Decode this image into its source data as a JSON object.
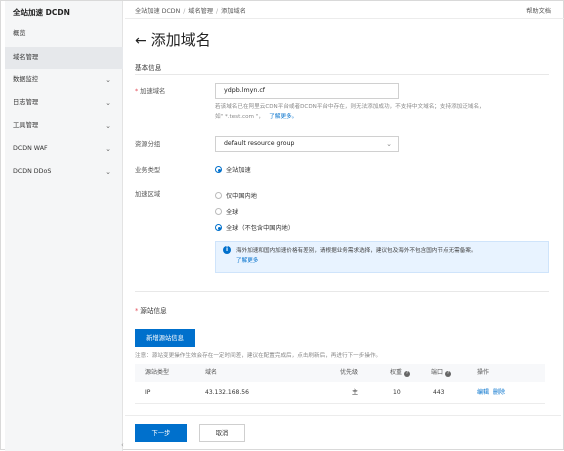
{
  "sidebar": {
    "brand": "全站加速 DCDN",
    "items": [
      {
        "label": "概览",
        "chevron": false,
        "active": false
      },
      {
        "label": "域名管理",
        "chevron": false,
        "active": true
      },
      {
        "label": "数据监控",
        "chevron": true,
        "active": false
      },
      {
        "label": "日志管理",
        "chevron": true,
        "active": false
      },
      {
        "label": "工具管理",
        "chevron": true,
        "active": false
      },
      {
        "label": "DCDN WAF",
        "chevron": true,
        "active": false
      },
      {
        "label": "DCDN DDoS",
        "chevron": true,
        "active": false
      }
    ]
  },
  "topbar": {
    "breadcrumb": [
      "全站加速 DCDN",
      "域名管理",
      "添加域名"
    ],
    "help": "帮助文档"
  },
  "page": {
    "back_arrow": "←",
    "title": "添加域名"
  },
  "basic": {
    "section_title": "基本信息",
    "domain_label": "加速域名",
    "domain_value": "ydpb.lmyn.cf",
    "domain_hint_1": "若该域名已在阿里云CDN平台或者DCDN平台中存在，则无法添加成功，不支持中文域名；支持添加泛域名，",
    "domain_hint_2": "如\"  *.test.com \"，",
    "domain_hint_link": "了解更多。",
    "resource_group_label": "资源分组",
    "resource_group_value": "default resource group",
    "business_type_label": "业务类型",
    "business_type_option": "全站加速",
    "region_label": "加速区域",
    "region_options": [
      "仅中国内地",
      "全球",
      "全球（不包含中国内地）"
    ],
    "region_selected": 2,
    "info_text": "海外加速和国内加速价格有差别，请根据业务需求选择，建议包及海外不包含国内节点无需备案。",
    "info_link": "了解更多"
  },
  "origin": {
    "section_title": "源站信息",
    "add_button": "新增源站信息",
    "note": "注意：源站变更操作生效会存在一定时间差，建议在配置完成后，点击刷新后，再进行下一步操作。",
    "columns": [
      "源站类型",
      "域名",
      "优先级",
      "权重",
      "端口",
      "操作"
    ],
    "rows": [
      {
        "type": "IP",
        "domain": "43.132.168.56",
        "priority": "主",
        "weight": "10",
        "port": "443",
        "actions": [
          "编辑",
          "删除"
        ]
      }
    ]
  },
  "footer": {
    "next_button": "下一步",
    "cancel_button": "取消"
  },
  "colors": {
    "accent": "#0070cc",
    "required": "#e34d59"
  },
  "icons": {
    "back": "arrow-left-icon",
    "chevron": "chevron-down-icon",
    "info": "info-icon",
    "help": "question-icon"
  }
}
